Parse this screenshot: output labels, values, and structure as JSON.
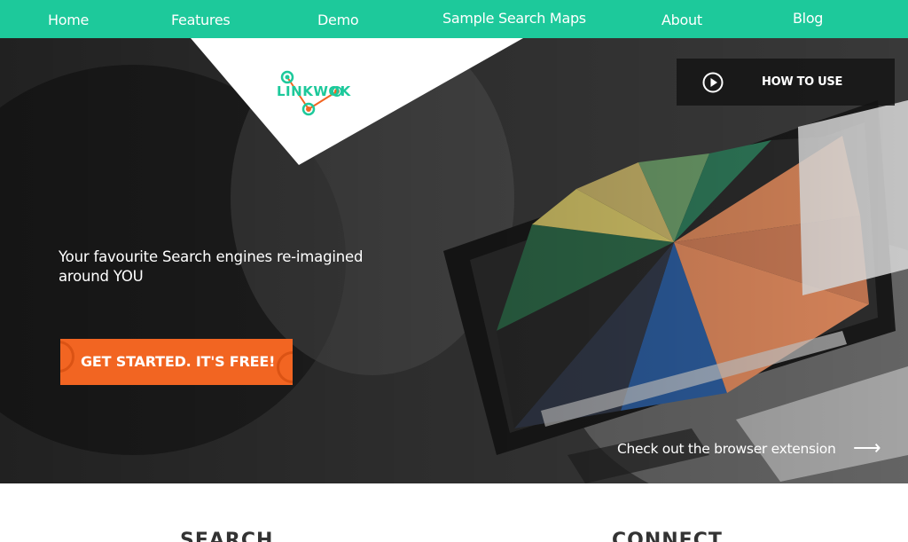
{
  "nav": {
    "home": "Home",
    "features": "Features",
    "demo": "Demo",
    "sample_maps": "Sample Search Maps",
    "about": "About",
    "blog": "Blog"
  },
  "brand": {
    "logo_text": "LINKWOK",
    "accent_green": "#1dc99b",
    "accent_orange": "#f26522"
  },
  "hero": {
    "how_to_use": "HOW TO USE",
    "tagline": "Your favourite Search engines re-imagined around YOU",
    "cta": "GET STARTED. IT'S FREE!",
    "extension_link": "Check out the browser extension",
    "extension_arrow": "⟶"
  },
  "sections": {
    "search": "SEARCH",
    "connect": "CONNECT"
  }
}
